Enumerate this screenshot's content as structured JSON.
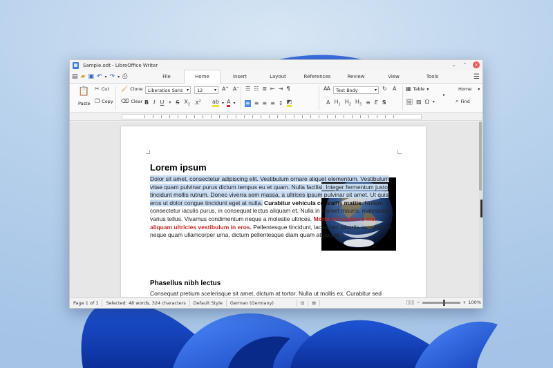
{
  "window": {
    "title": "Sample.odt - LibreOffice Writer"
  },
  "tabs": [
    "File",
    "Home",
    "Insert",
    "Layout",
    "References",
    "Review",
    "View",
    "Tools"
  ],
  "active_tab": "Home",
  "ribbon": {
    "cut": "Cut",
    "paste": "Paste",
    "copy": "Copy",
    "clone": "Clone",
    "clear": "Clear",
    "font_name": "Liberation Sans",
    "font_size": "12",
    "paragraph_style": "Text Body",
    "table": "Table",
    "home": "Home",
    "find": "Find"
  },
  "document": {
    "heading1": "Lorem ipsum",
    "para1_selected": "Dolor sit amet, consectetur adipiscing elit. Vestibulum ornare aliquet elementum. Vestibulum vitae quam pulvinar purus dictum tempus eu et quam. Nulla facilisi. Integer fermentum justo tincidunt mollis rutrum. Donec viverra sem massa, a ultrices ipsum pulvinar sit amet. Ut quis eros ut dolor congue tincidunt eget at nulla.",
    "para1_bold": "Curabitur vehicula convallis mattis.",
    "para1_plain": "Nullam consectetur iaculis purus, in consequat lectus aliquam et. Nulla in laoreet mauris, malesuada varius tellus. Vivamus condimentum neque a molestie ultrices.",
    "para1_red": "Morbi vel sapien a nisi aliquam ultricies vestibulum in eros.",
    "para1_end": "Pellentesque tincidunt, lacus nec lobortis consectetur, neque quam ullamcorper urna, dictum pellentesque diam quam at augue.",
    "heading2": "Phasellus nibh lectus",
    "para2": "Consequat pretium scelerisque sit amet, dictum at tortor. Nulla ut mollis ex. Curabitur sed"
  },
  "status": {
    "page": "Page 1 of 1",
    "selection": "Selected: 48 words, 324 characters",
    "page_style": "Default Style",
    "language": "German (Germany)",
    "zoom": "100%"
  }
}
